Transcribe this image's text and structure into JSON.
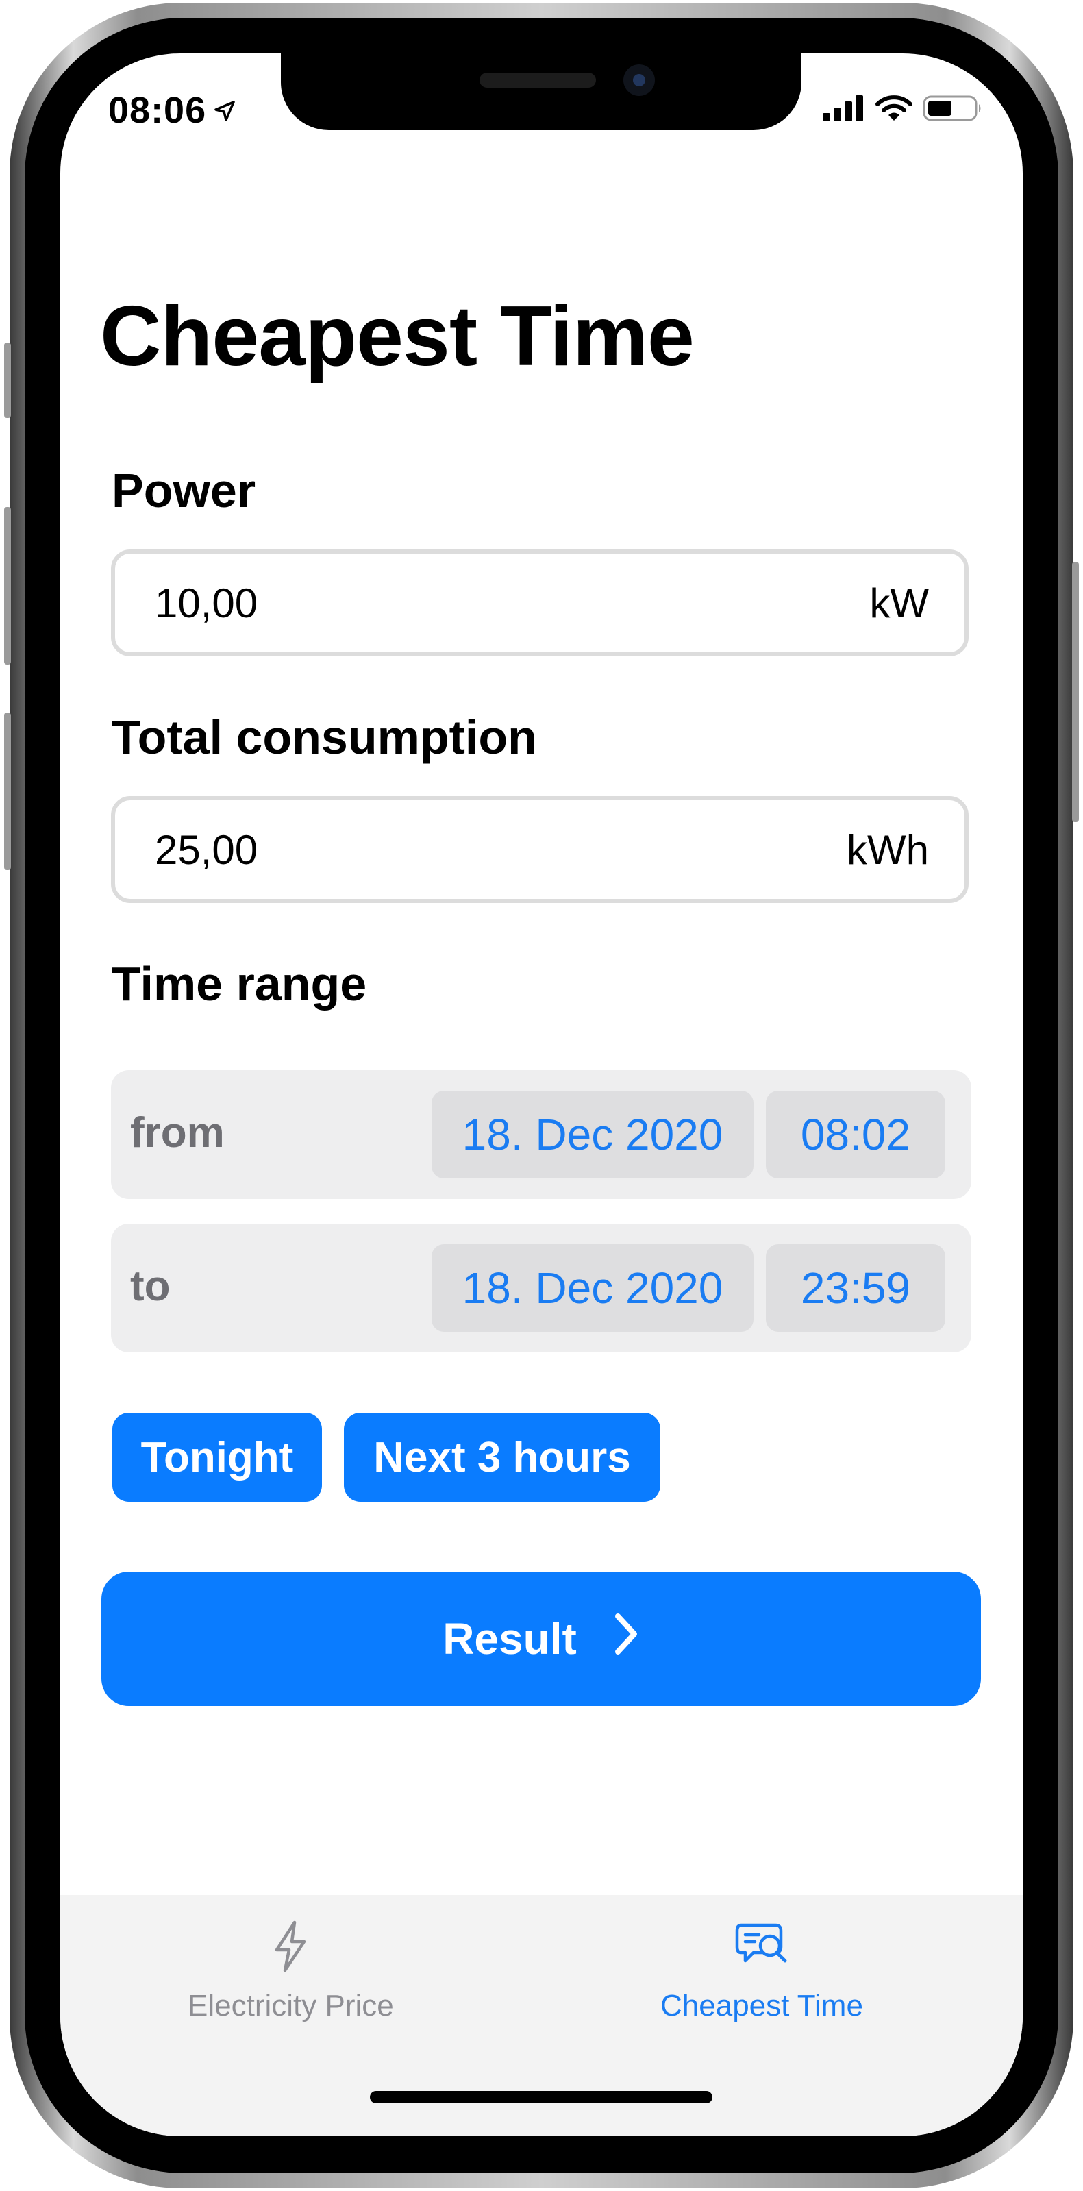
{
  "status_bar": {
    "time": "08:06"
  },
  "page": {
    "title": "Cheapest Time"
  },
  "power": {
    "label": "Power",
    "value": "10,00",
    "unit": "kW"
  },
  "consumption": {
    "label": "Total consumption",
    "value": "25,00",
    "unit": "kWh"
  },
  "time_range": {
    "label": "Time range",
    "from": {
      "label": "from",
      "date": "18. Dec 2020",
      "time": "08:02"
    },
    "to": {
      "label": "to",
      "date": "18. Dec 2020",
      "time": "23:59"
    }
  },
  "quick_buttons": {
    "tonight": "Tonight",
    "next_3_hours": "Next 3 hours"
  },
  "result_button": {
    "label": "Result"
  },
  "tab_bar": {
    "electricity_price": "Electricity Price",
    "cheapest_time": "Cheapest Time"
  },
  "colors": {
    "accent": "#0A7CFF",
    "accent_text": "#1A7CF2",
    "inactive_tab": "#8E8E93",
    "range_background": "#EEEEEF",
    "pill_background": "#DEDEE0"
  },
  "icons": {
    "location": "location-arrow-icon",
    "signal": "cellular-signal-icon",
    "wifi": "wifi-icon",
    "battery": "battery-icon",
    "chevron": "chevron-right-icon",
    "electricity_tab": "lightning-bolt-icon",
    "cheapest_tab": "search-message-icon"
  }
}
